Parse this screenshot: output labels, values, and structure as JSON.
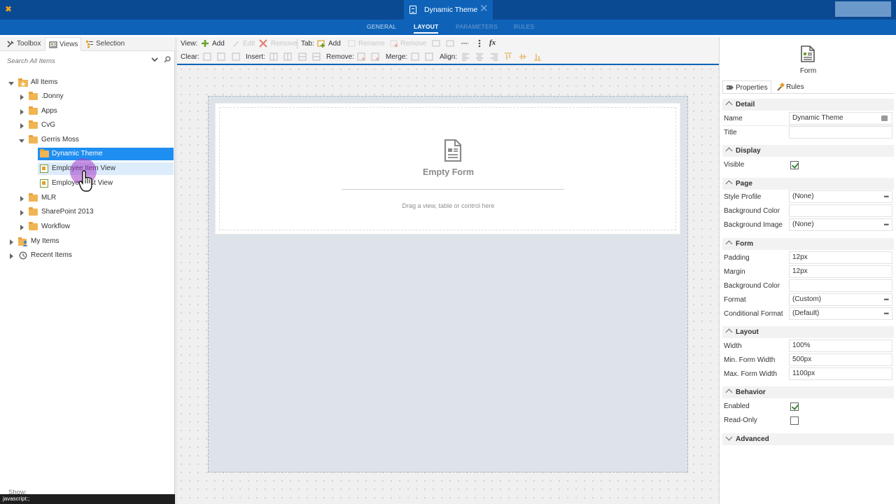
{
  "topbar": {
    "document_tab_title": "Dynamic Theme"
  },
  "nav": {
    "items": [
      {
        "label": "GENERAL",
        "state": "normal"
      },
      {
        "label": "LAYOUT",
        "state": "active"
      },
      {
        "label": "PARAMETERS",
        "state": "disabled"
      },
      {
        "label": "RULES",
        "state": "disabled"
      }
    ]
  },
  "left_panel": {
    "tabs": [
      {
        "label": "Toolbox",
        "icon": "wrench-icon"
      },
      {
        "label": "Views",
        "icon": "views-icon"
      },
      {
        "label": "Selection",
        "icon": "selection-icon"
      }
    ],
    "search_placeholder": "Search All Items",
    "tree": [
      {
        "label": "All Items",
        "level": 0,
        "expanded": true,
        "icon": "all-items-icon"
      },
      {
        "label": ".Donny",
        "level": 1,
        "expanded": false,
        "icon": "folder-icon"
      },
      {
        "label": "Apps",
        "level": 1,
        "expanded": false,
        "icon": "folder-icon"
      },
      {
        "label": "CvG",
        "level": 1,
        "expanded": false,
        "icon": "folder-icon"
      },
      {
        "label": "Gerris Moss",
        "level": 1,
        "expanded": true,
        "icon": "folder-icon"
      },
      {
        "label": "Dynamic Theme",
        "level": 2,
        "selected": true,
        "icon": "folder-icon"
      },
      {
        "label": "Employee Item View",
        "level": 2,
        "hover": true,
        "icon": "view-icon"
      },
      {
        "label": "Employee List View",
        "level": 2,
        "icon": "view-icon"
      },
      {
        "label": "MLR",
        "level": 1,
        "expanded": false,
        "icon": "folder-icon"
      },
      {
        "label": "SharePoint 2013",
        "level": 1,
        "expanded": false,
        "icon": "folder-icon"
      },
      {
        "label": "Workflow",
        "level": 1,
        "expanded": false,
        "icon": "folder-icon"
      },
      {
        "label": "My Items",
        "level": 0,
        "expanded": false,
        "icon": "my-items-icon"
      },
      {
        "label": "Recent Items",
        "level": 0,
        "expanded": false,
        "icon": "recent-items-icon"
      }
    ],
    "show_label": "Show:",
    "status_tip": "javascript:;"
  },
  "toolbar": {
    "view_label": "View:",
    "view_add": "Add",
    "view_edit": "Edit",
    "view_remove": "Remove",
    "tab_label": "Tab:",
    "tab_add": "Add",
    "tab_rename": "Rename",
    "tab_remove": "Remove",
    "fx": "fx",
    "clear_label": "Clear:",
    "insert_label": "Insert:",
    "remove_label": "Remove:",
    "merge_label": "Merge:",
    "align_label": "Align:"
  },
  "canvas": {
    "empty_title": "Empty Form",
    "empty_hint": "Drag a view, table or control here"
  },
  "right_panel": {
    "title": "Form",
    "tabs": [
      {
        "label": "Properties",
        "icon": "properties-icon",
        "active": true
      },
      {
        "label": "Rules",
        "icon": "rules-icon",
        "active": false
      }
    ],
    "sections": {
      "detail": {
        "title": "Detail",
        "name_label": "Name",
        "name_value": "Dynamic Theme",
        "title_label": "Title",
        "title_value": ""
      },
      "display": {
        "title": "Display",
        "visible_label": "Visible",
        "visible": true
      },
      "page": {
        "title": "Page",
        "style_profile_label": "Style Profile",
        "style_profile_value": "(None)",
        "bg_color_label": "Background Color",
        "bg_color_value": "",
        "bg_image_label": "Background Image",
        "bg_image_value": "(None)"
      },
      "form": {
        "title": "Form",
        "padding_label": "Padding",
        "padding_value": "12px",
        "margin_label": "Margin",
        "margin_value": "12px",
        "bg_color_label": "Background Color",
        "bg_color_value": "",
        "format_label": "Format",
        "format_value": "(Custom)",
        "cond_format_label": "Conditional Format",
        "cond_format_value": "(Default)"
      },
      "layout": {
        "title": "Layout",
        "width_label": "Width",
        "width_value": "100%",
        "min_width_label": "Min. Form Width",
        "min_width_value": "500px",
        "max_width_label": "Max. Form Width",
        "max_width_value": "1100px"
      },
      "behavior": {
        "title": "Behavior",
        "enabled_label": "Enabled",
        "enabled": true,
        "readonly_label": "Read-Only",
        "readonly": false
      },
      "advanced": {
        "title": "Advanced"
      }
    }
  },
  "colors": {
    "topbar_bg": "#0a4a92",
    "navbar_bg": "#0e63b9",
    "selection": "#1f8ef1",
    "folder": "#f0b553",
    "cursor_halo": "#a03cc8"
  }
}
